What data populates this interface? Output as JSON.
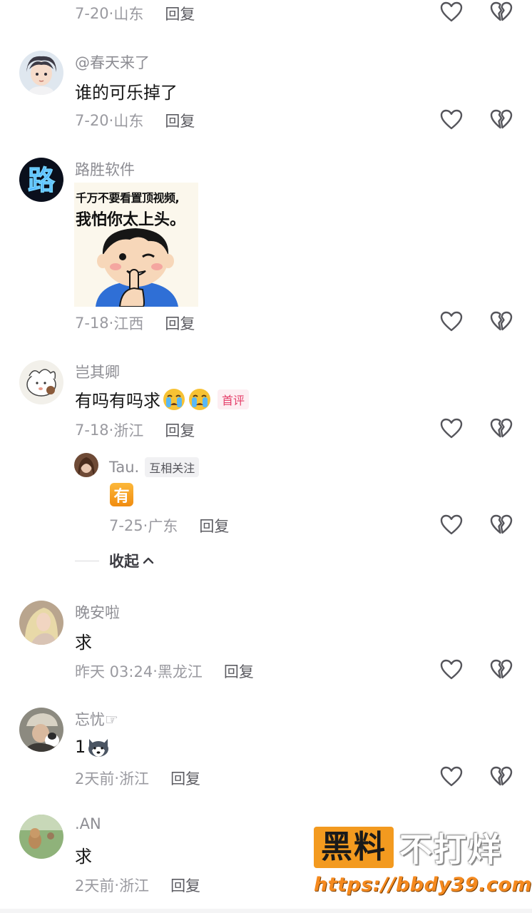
{
  "comments": [
    {
      "meta": {
        "date": "7-20",
        "region": "山东",
        "reply": "回复"
      }
    },
    {
      "username": "@春天来了",
      "text": "谁的可乐掉了",
      "meta": {
        "date": "7-20",
        "region": "山东",
        "reply": "回复"
      }
    },
    {
      "username": "路胜软件",
      "sticker": {
        "line1": "千万不要看置顶视频,",
        "line2": "我怕你太上头。"
      },
      "meta": {
        "date": "7-18",
        "region": "江西",
        "reply": "回复"
      }
    },
    {
      "username": "岂其卿",
      "text": "有吗有吗求",
      "emojis": [
        "crying-face",
        "crying-face"
      ],
      "badge": "首评",
      "meta": {
        "date": "7-18",
        "region": "浙江",
        "reply": "回复"
      },
      "replies": [
        {
          "username": "Tau.",
          "badge": "互相关注",
          "text": "有",
          "meta": {
            "date": "7-25",
            "region": "广东",
            "reply": "回复"
          }
        }
      ],
      "collapse_label": "收起"
    },
    {
      "username": "晚安啦",
      "text": "求",
      "meta": {
        "date": "昨天 03:24",
        "region": "黑龙江",
        "reply": "回复"
      }
    },
    {
      "username": "忘忧☞",
      "text": "1",
      "emojis": [
        "husky-face"
      ],
      "meta": {
        "date": "2天前",
        "region": "浙江",
        "reply": "回复"
      }
    },
    {
      "username": ".AN",
      "text": "求",
      "meta": {
        "date": "2天前",
        "region": "浙江",
        "reply": "回复"
      }
    }
  ],
  "watermark": {
    "brand_box": "黑料",
    "brand_text": "不打烊",
    "url": "https://bbdy39.com"
  },
  "icons": {
    "like": "heart-outline-icon",
    "dislike": "broken-heart-icon",
    "collapse": "chevron-up-icon"
  },
  "colors": {
    "username": "#8d8d93",
    "text": "#161616",
    "meta": "#9a9aa0",
    "first_badge": "#e5406b",
    "watermark_orange": "#f39a1f"
  }
}
